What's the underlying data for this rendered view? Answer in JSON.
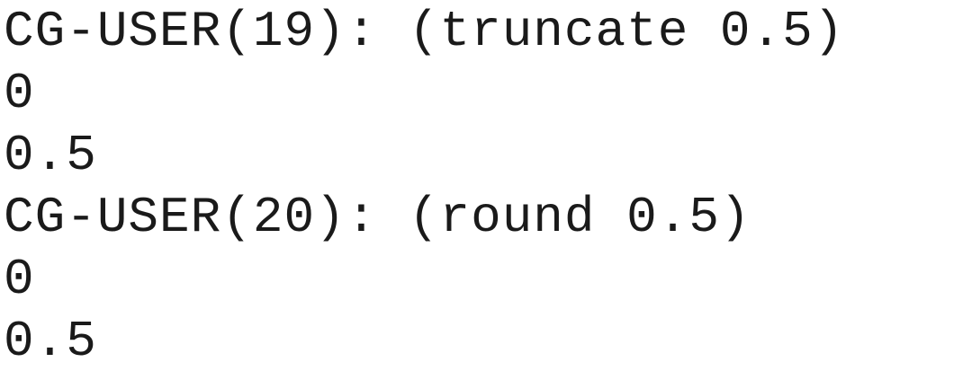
{
  "repl": {
    "lines": [
      {
        "text": "CG-USER(19): (truncate 0.5)"
      },
      {
        "text": "0"
      },
      {
        "text": "0.5"
      },
      {
        "text": "CG-USER(20): (round 0.5)"
      },
      {
        "text": "0"
      },
      {
        "text": "0.5"
      }
    ]
  }
}
